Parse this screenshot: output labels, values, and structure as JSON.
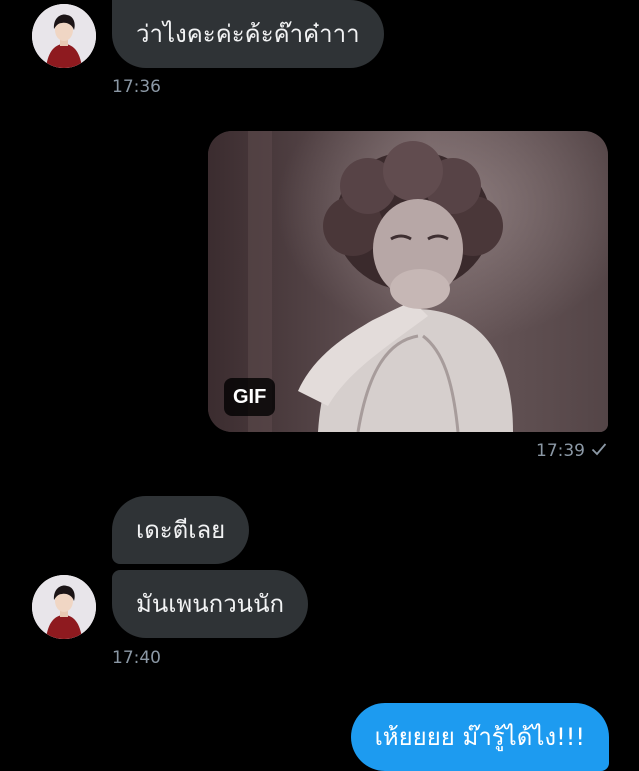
{
  "conversation": {
    "messages": [
      {
        "sender": "other",
        "text": "ว่าไงคะค่ะค้ะค๊าค๋าาา",
        "time": "17:36"
      },
      {
        "sender": "me",
        "type": "gif",
        "badge": "GIF",
        "time": "17:39"
      },
      {
        "sender": "other",
        "text": "เดะตีเลย"
      },
      {
        "sender": "other",
        "text": "มันเพนกวนนัก",
        "time": "17:40"
      },
      {
        "sender": "me",
        "text": "เห้ยยยย ม๊ารู้ได้ไง!!!"
      }
    ]
  },
  "colors": {
    "background": "#000000",
    "incoming_bubble": "#2f3336",
    "outgoing_bubble": "#1d9bf0",
    "timestamp": "#8b98a5"
  },
  "icons": {
    "avatar": "avatar-photo",
    "read_receipt": "check-icon"
  }
}
